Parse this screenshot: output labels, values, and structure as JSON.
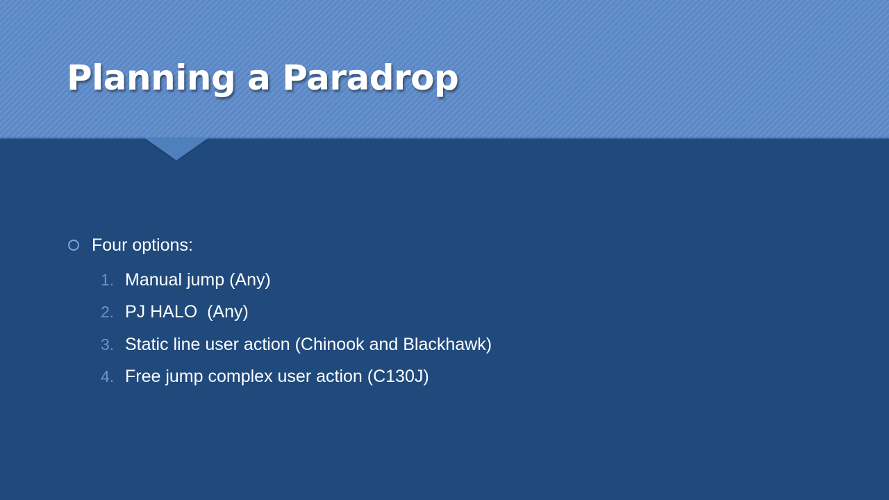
{
  "slide": {
    "title": "Planning a Paradrop",
    "bullet": {
      "icon": "hollow-circle-bullet",
      "text": "Four options:"
    },
    "options": [
      {
        "number": "1.",
        "text": "Manual jump (Any)"
      },
      {
        "number": "2.",
        "text": "PJ HALO  (Any)"
      },
      {
        "number": "3.",
        "text": "Static line user action (Chinook and Blackhawk)"
      },
      {
        "number": "4.",
        "text": "Free jump complex user action (C130J)"
      }
    ]
  },
  "colors": {
    "background": "#20497c",
    "header": "#5b88c6",
    "bullet_accent": "#7ea6db",
    "number_accent": "#6f93c6",
    "text": "#ffffff"
  }
}
